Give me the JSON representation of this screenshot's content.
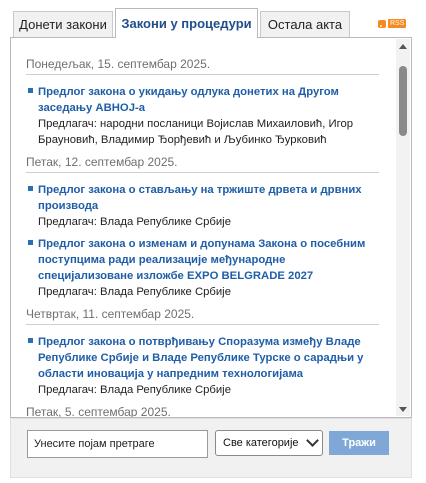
{
  "tabs": [
    {
      "label": "Донети закони"
    },
    {
      "label": "Закони у процедури"
    },
    {
      "label": "Остала акта"
    }
  ],
  "rss": {
    "label": "RSS",
    "icon": "rss-icon",
    "color": "#f68a1e"
  },
  "groups": [
    {
      "date": "Понедељак, 15. септембар 2025.",
      "items": [
        {
          "title": "Предлог закона о укидању одлука донетих на Другом заседању АВНОЈ-а",
          "proposer": "Предлагач: народни посланици Војислав Михаиловић, Игор Брауновић, Владимир Ђорђевић и Љубинко Ђурковић"
        }
      ]
    },
    {
      "date": "Петак, 12. септембар 2025.",
      "items": [
        {
          "title": "Предлог закона о стављању на тржиште дрвета и дрвних производа",
          "proposer": "Предлагач: Влада Републике Србије"
        },
        {
          "title": "Предлог закона о изменам и допунама Закона о посебним поступцима ради реализације међународне специјализоване изложбе EXPO BELGRADE 2027",
          "proposer": "Предлагач: Влада Републике Србије"
        }
      ]
    },
    {
      "date": "Четвртак, 11. септембар 2025.",
      "items": [
        {
          "title": "Предлог закона о потврђивању Споразума између Владе Републике Србије и Владе Републике Турске о сарадњи у области иновација у напредним технологијама",
          "proposer": "Предлагач: Влада Републике Србије"
        }
      ]
    },
    {
      "date": "Петак, 5. септембар 2025.",
      "items": []
    }
  ],
  "search": {
    "value": "Унесите појам претраге",
    "category": "Све категорије",
    "button": "Тражи"
  },
  "colors": {
    "link": "#1f5ea8",
    "date": "#6f6f6f",
    "button": "#7fa8d6",
    "bullet": "#2a6fb3"
  }
}
